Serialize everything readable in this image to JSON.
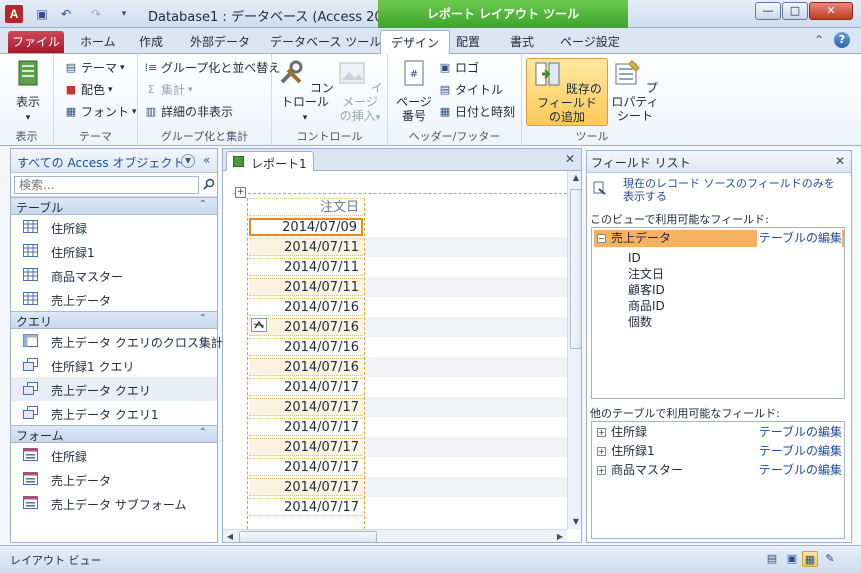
{
  "window": {
    "title": "Database1 : データベース (Access 200...",
    "tool_tab_title": "レポート レイアウト ツール",
    "minimize": "—",
    "maximize": "□",
    "close": "✕"
  },
  "ribbon_tabs": [
    "ファイル",
    "ホーム",
    "作成",
    "外部データ",
    "データベース ツール",
    "デザイン",
    "配置",
    "書式",
    "ページ設定"
  ],
  "ribbon": {
    "view": {
      "label": "表示",
      "group": "表示"
    },
    "theme": {
      "themes": "テーマ",
      "colors": "配色",
      "fonts": "フォント",
      "group": "テーマ"
    },
    "grouping": {
      "group_sort": "グループ化と並べ替え",
      "totals": "集計",
      "hide_details": "詳細の非表示",
      "group": "グループ化と集計"
    },
    "controls": {
      "control": "コントロール",
      "insert_image_1": "イメージ",
      "insert_image_2": "の挿入",
      "group": "コントロール"
    },
    "header_footer": {
      "page_numbers_1": "ページ",
      "page_numbers_2": "番号",
      "logo": "ロゴ",
      "title": "タイトル",
      "date_time": "日付と時刻",
      "group": "ヘッダー/フッター"
    },
    "tools": {
      "add_fields_1": "既存のフィールド",
      "add_fields_2": "の追加",
      "property_1": "プロパティ",
      "property_2": "シート",
      "group": "ツール"
    }
  },
  "nav_pane": {
    "title": "すべての Access オブジェクト",
    "search_placeholder": "検索...",
    "sections": [
      {
        "name": "テーブル",
        "items": [
          "住所録",
          "住所録1",
          "商品マスター",
          "売上データ"
        ]
      },
      {
        "name": "クエリ",
        "items": [
          "売上データ クエリのクロス集計",
          "住所録1 クエリ",
          "売上データ クエリ",
          "売上データ クエリ1"
        ]
      },
      {
        "name": "フォーム",
        "items": [
          "住所録",
          "売上データ",
          "売上データ サブフォーム"
        ]
      }
    ]
  },
  "document": {
    "tab_label": "レポート1",
    "column_header": "注文日",
    "rows": [
      "2014/07/09",
      "2014/07/11",
      "2014/07/11",
      "2014/07/11",
      "2014/07/16",
      "2014/07/16",
      "2014/07/16",
      "2014/07/16",
      "2014/07/17",
      "2014/07/17",
      "2014/07/17",
      "2014/07/17",
      "2014/07/17",
      "2014/07/17",
      "2014/07/17"
    ]
  },
  "field_list": {
    "title": "フィールド リスト",
    "show_current_only": "現在のレコード ソースのフィールドのみを表示する",
    "available_label": "このビューで利用可能なフィールド:",
    "main_table": "売上データ",
    "edit_table": "テーブルの編集",
    "fields": [
      "ID",
      "注文日",
      "顧客ID",
      "商品ID",
      "個数"
    ],
    "other_label": "他のテーブルで利用可能なフィールド:",
    "other_tables": [
      "住所録",
      "住所録1",
      "商品マスター"
    ]
  },
  "status_bar": {
    "text": "レイアウト ビュー"
  },
  "colors": {
    "accent_green": "#3da32a",
    "file_tab_red": "#a4192e",
    "selection_orange": "#e58a1f"
  }
}
